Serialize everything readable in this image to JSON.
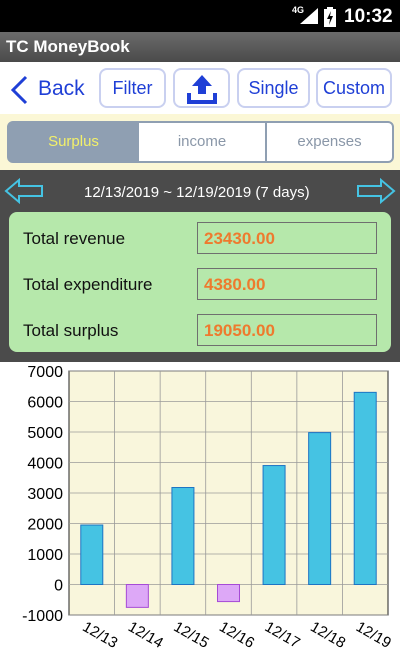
{
  "status_bar": {
    "network": "4G",
    "time": "10:32"
  },
  "app": {
    "title": "TC MoneyBook"
  },
  "toolbar": {
    "back_label": "Back",
    "filter_label": "Filter",
    "single_label": "Single",
    "custom_label": "Custom"
  },
  "tabs": [
    {
      "label": "Surplus",
      "active": true
    },
    {
      "label": "income",
      "active": false
    },
    {
      "label": "expenses",
      "active": false
    }
  ],
  "date_range": "12/13/2019 ~ 12/19/2019  (7 days)",
  "summary": {
    "revenue_label": "Total revenue",
    "revenue_value": "23430.00",
    "expenditure_label": "Total expenditure",
    "expenditure_value": "4380.00",
    "surplus_label": "Total surplus",
    "surplus_value": "19050.00"
  },
  "colors": {
    "accent": "#1f3fd6",
    "positive_bar": "#45c3e3",
    "negative_bar": "#dda8f7",
    "value_text": "#ee7a2e",
    "card_bg": "#b6e8ab",
    "chart_bg": "#f9f6dc"
  },
  "chart_data": {
    "type": "bar",
    "categories": [
      "12/13",
      "12/14",
      "12/15",
      "12/16",
      "12/17",
      "12/18",
      "12/19"
    ],
    "values": [
      1950,
      -750,
      3180,
      -560,
      3900,
      4980,
      6300
    ],
    "ylim": [
      -1000,
      7000
    ],
    "yticks": [
      -1000,
      0,
      1000,
      2000,
      3000,
      4000,
      5000,
      6000,
      7000
    ],
    "grid": true,
    "title": "",
    "xlabel": "",
    "ylabel": ""
  }
}
